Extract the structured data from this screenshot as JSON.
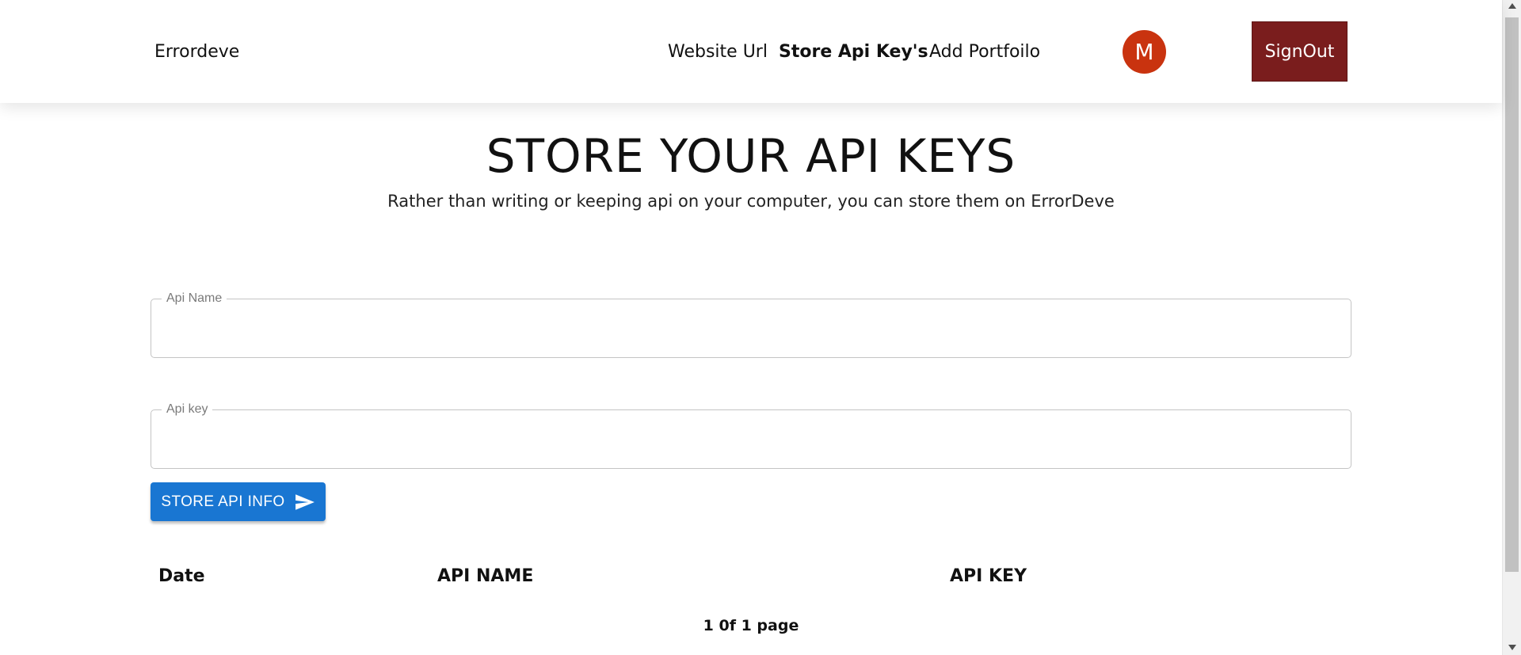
{
  "header": {
    "brand": "Errordeve",
    "nav": {
      "website_url": "Website Url",
      "store_api_keys": "Store Api Key's",
      "add_portfolio": "Add Portfoilo"
    },
    "avatar_initial": "M",
    "signout_label": "SignOut"
  },
  "main": {
    "title": "STORE YOUR API KEYS",
    "subtitle": "Rather than writing or keeping api on your computer, you can store them on ErrorDeve",
    "form": {
      "api_name_label": "Api Name",
      "api_name_value": "",
      "api_key_label": "Api key",
      "api_key_value": "",
      "submit_label": "STORE API INFO"
    },
    "table": {
      "columns": [
        "Date",
        "API NAME",
        "API KEY"
      ],
      "rows": []
    },
    "pagination": "1 0f 1 page"
  },
  "colors": {
    "signout_bg": "#7a1d1d",
    "avatar_bg": "#c9330f",
    "primary_button": "#1976d2"
  },
  "icons": {
    "submit_icon": "send-icon"
  }
}
